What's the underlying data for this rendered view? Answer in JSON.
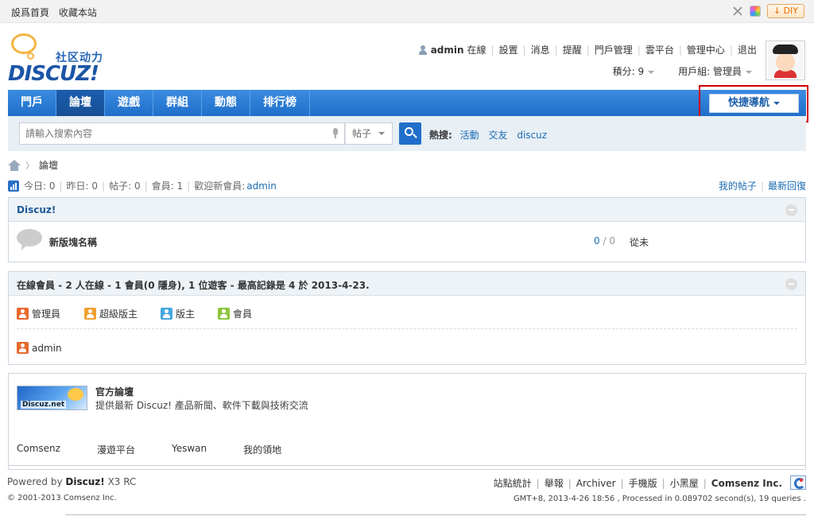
{
  "topbar": {
    "links": [
      "設爲首頁",
      "收藏本站"
    ],
    "diy_label": "DIY"
  },
  "logo": {
    "slogan": "社区动力",
    "word": "DISCUZ!"
  },
  "user": {
    "name": "admin",
    "status": "在線",
    "links": [
      "設置",
      "消息",
      "提醒",
      "門戶管理",
      "雲平台",
      "管理中心",
      "退出"
    ],
    "points": "積分: 9",
    "group": "用戶組: 管理員"
  },
  "nav": {
    "items": [
      "門戶",
      "論壇",
      "遊戲",
      "群組",
      "動態",
      "排行榜"
    ],
    "active_index": 1,
    "quick_nav": "快捷導航"
  },
  "search": {
    "placeholder": "請輸入搜索內容",
    "type": "帖子",
    "hot_label": "熱搜:",
    "hot_terms": [
      "活動",
      "交友",
      "discuz"
    ]
  },
  "breadcrumb": {
    "current": "論壇"
  },
  "stats": {
    "today": "今日: 0",
    "yesterday": "昨日: 0",
    "posts": "帖子: 0",
    "members": "會員: 1",
    "welcome": "歡迎新會員:",
    "newest_member": "admin",
    "my_posts": "我的帖子",
    "latest_replies": "最新回復"
  },
  "forum_group": {
    "title": "Discuz!",
    "forum_name": "新版塊名稱",
    "threads": "0",
    "posts": "0",
    "last_post": "從未"
  },
  "online": {
    "title": "在線會員 - 2 人在線 - 1 會員(0 隱身), 1 位遊客 - 最高記錄是 4 於 2013-4-23.",
    "legend": [
      {
        "label": "管理員",
        "color": "#e8692d"
      },
      {
        "label": "超級版主",
        "color": "#f0a030"
      },
      {
        "label": "版主",
        "color": "#45a7e0"
      },
      {
        "label": "會員",
        "color": "#8cc63e"
      }
    ],
    "users": [
      {
        "name": "admin",
        "color": "#e8692d"
      }
    ]
  },
  "links_panel": {
    "banner_text": "Discuz.net",
    "title": "官方論壇",
    "desc": "提供最新 Discuz! 產品新聞、軟件下載與技術交流",
    "text_links": [
      "Comsenz",
      "漫遊平台",
      "Yeswan",
      "我的領地"
    ]
  },
  "footer": {
    "powered_prefix": "Powered by",
    "powered_brand": "Discuz!",
    "powered_version": "X3 RC",
    "copyright": "© 2001-2013 Comsenz Inc.",
    "links": [
      "站點統計",
      "舉報",
      "Archiver",
      "手機版",
      "小黑屋"
    ],
    "company": "Comsenz Inc.",
    "processed": "GMT+8, 2013-4-26 18:56 , Processed in 0.089702 second(s), 19 queries ."
  }
}
